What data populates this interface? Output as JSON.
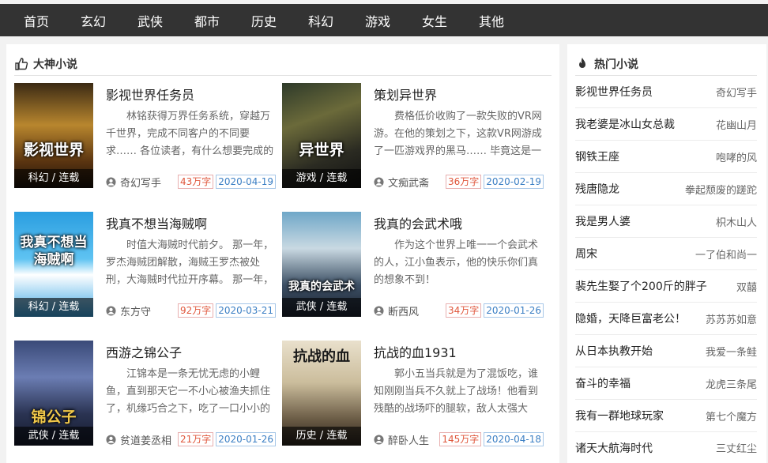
{
  "nav": [
    "首页",
    "玄幻",
    "武侠",
    "都市",
    "历史",
    "科幻",
    "游戏",
    "女生",
    "其他"
  ],
  "left": {
    "title": "大神小说",
    "books": [
      {
        "title": "影视世界任务员",
        "desc": "林铭获得万界任务系统，穿越万千世界，完成不同客户的不同要求…… 各位读者，有什么想要完成的任务都可以在书评区提出来。",
        "author": "奇幻写手",
        "words": "43万字",
        "date": "2020-04-19",
        "cover_text": "影视世界",
        "cat": "科幻 / 连载"
      },
      {
        "title": "策划异世界",
        "desc": "费格低价收购了一款失败的VR网游。在他的策划之下，这款VR网游成了一匹游戏界的黑马…… 毕竟这是一个真实的异世界。",
        "author": "文痴武斋",
        "words": "36万字",
        "date": "2020-02-19",
        "cover_text": "异世界",
        "cat": "游戏 / 连载"
      },
      {
        "title": "我真不想当海贼啊",
        "desc": "时值大海贼时代前夕。 那一年，罗杰海贼团解散，海贼王罗杰被处刑，大海贼时代拉开序幕。 那一年，我来到了这个世界。",
        "author": "东方守",
        "words": "92万字",
        "date": "2020-03-21",
        "cover_text": "我真不想当海贼啊",
        "cat": "科幻 / 连载"
      },
      {
        "title": "我真的会武术哦",
        "desc": "作为这个世界上唯一一个会武术的人，江小鱼表示，他的快乐你们真的想象不到！",
        "author": "断西风",
        "words": "34万字",
        "date": "2020-01-26",
        "cover_text": "我真的会武术",
        "cat": "武侠 / 连载"
      },
      {
        "title": "西游之锦公子",
        "desc": "江锦本是一条无忧无虑的小鲤鱼，直到那天它一不小心被渔夫抓住了，机缘巧合之下，吃了一口小小的仙丹。",
        "author": "贫道姜丞相",
        "words": "21万字",
        "date": "2020-01-26",
        "cover_text": "锦公子",
        "cat": "武侠 / 连载"
      },
      {
        "title": "抗战的血1931",
        "desc": "郭小五当兵就是为了混饭吃，谁知刚刚当兵不久就上了战场！他看到残酷的战场吓的腿软，敌人太强大了。",
        "author": "醉卧人生",
        "words": "145万字",
        "date": "2020-04-18",
        "cover_text": "抗战的血",
        "cat": "历史 / 连载"
      }
    ]
  },
  "right": {
    "title": "热门小说",
    "items": [
      {
        "name": "影视世界任务员",
        "author": "奇幻写手"
      },
      {
        "name": "我老婆是冰山女总裁",
        "author": "花幽山月"
      },
      {
        "name": "钢铁王座",
        "author": "咆哮的风"
      },
      {
        "name": "残唐隐龙",
        "author": "拳起颓废的蹉跎"
      },
      {
        "name": "我是男人婆",
        "author": "枳木山人"
      },
      {
        "name": "周宋",
        "author": "一了伯和尚一"
      },
      {
        "name": "裴先生娶了个200斤的胖子",
        "author": "双囍"
      },
      {
        "name": "隐婚，天降巨富老公！",
        "author": "苏苏苏如意"
      },
      {
        "name": "从日本执教开始",
        "author": "我爱一条鲑"
      },
      {
        "name": "奋斗的幸福",
        "author": "龙虎三条尾"
      },
      {
        "name": "我有一群地球玩家",
        "author": "第七个魔方"
      },
      {
        "name": "诸天大航海时代",
        "author": "三丈红尘"
      }
    ]
  },
  "colors": {
    "nav_bg": "#333333",
    "words_tag": "#e0573c",
    "date_tag": "#3b7fc4"
  }
}
